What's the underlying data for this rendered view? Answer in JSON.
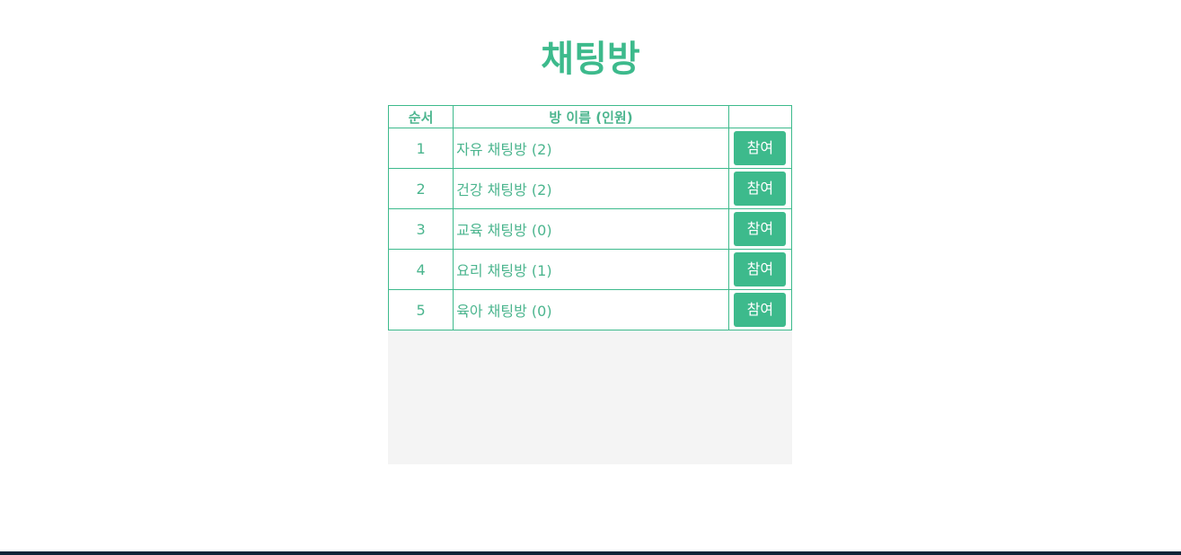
{
  "page": {
    "title": "채팅방"
  },
  "table": {
    "headers": {
      "order": "순서",
      "room_name": "방 이름 (인원)",
      "action": ""
    },
    "rows": [
      {
        "order": "1",
        "name": "자유 채팅방 (2)",
        "join_label": "참여"
      },
      {
        "order": "2",
        "name": "건강 채팅방 (2)",
        "join_label": "참여"
      },
      {
        "order": "3",
        "name": "교육 채팅방 (0)",
        "join_label": "참여"
      },
      {
        "order": "4",
        "name": "요리 채팅방 (1)",
        "join_label": "참여"
      },
      {
        "order": "5",
        "name": "육아 채팅방 (0)",
        "join_label": "참여"
      }
    ]
  },
  "colors": {
    "accent": "#3dba8c",
    "text": "#4bb58e",
    "panel_background": "#f4f4f4",
    "footer": "#0e2438"
  }
}
